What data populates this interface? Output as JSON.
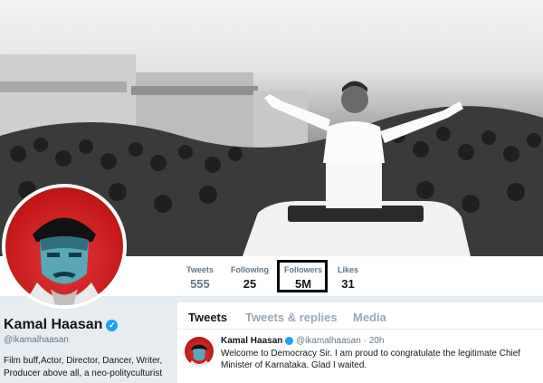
{
  "profile": {
    "name": "Kamal Haasan",
    "handle": "@ikamalhaasan",
    "bio": "Film buff,Actor, Director, Dancer, Writer, Producer above all, a neo-polityculturist",
    "verified_icon": "verified-badge-icon"
  },
  "stats": [
    {
      "label": "Tweets",
      "value": "555"
    },
    {
      "label": "Following",
      "value": "25"
    },
    {
      "label": "Followers",
      "value": "5M"
    },
    {
      "label": "Likes",
      "value": "31"
    }
  ],
  "tabs": [
    "Tweets",
    "Tweets & replies",
    "Media"
  ],
  "tweet": {
    "author": "Kamal Haasan",
    "handle": "@ikamalhaasan",
    "time": "20h",
    "text": "Welcome to Democracy Sir. I am proud to congratulate the legitimate Chief Minister of Karnataka. Glad I waited."
  },
  "colors": {
    "accent": "#1da1f2",
    "avatar_bg": "#c21616",
    "highlight_box": "#000000"
  }
}
